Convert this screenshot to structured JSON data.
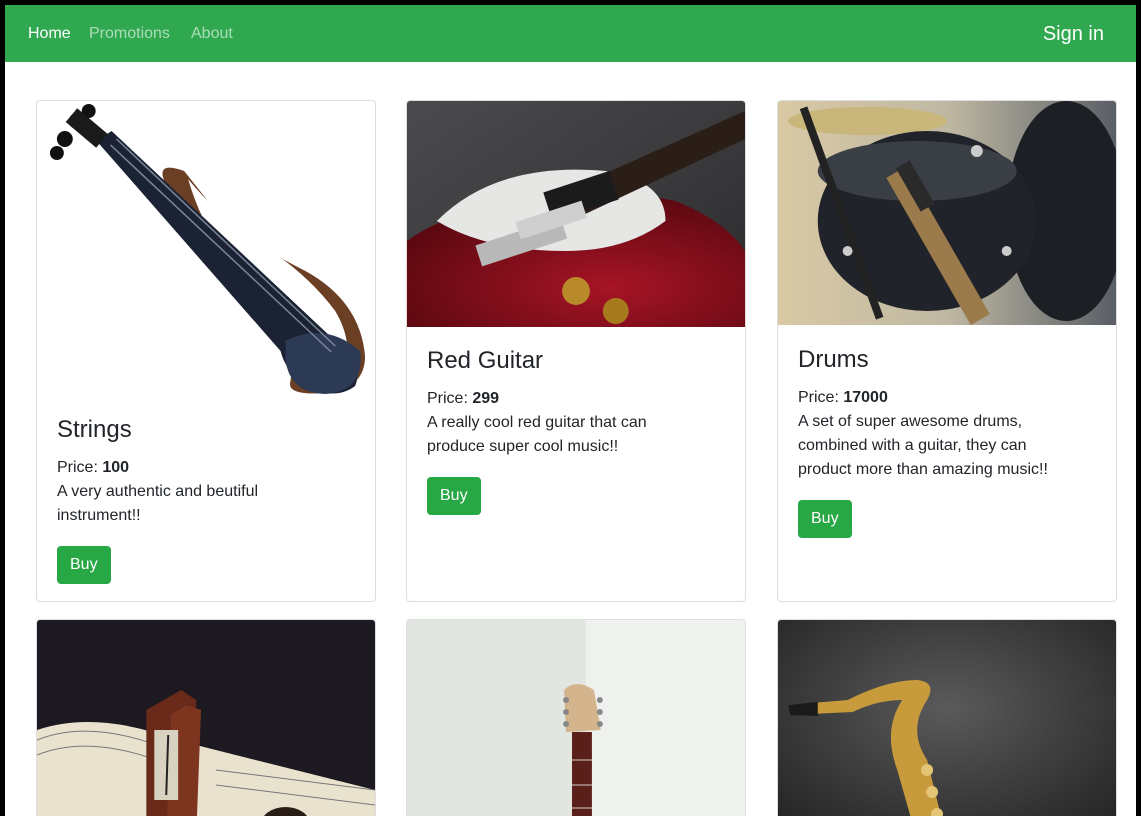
{
  "navbar": {
    "links": [
      {
        "label": "Home",
        "active": true
      },
      {
        "label": "Promotions",
        "active": false
      },
      {
        "label": "About",
        "active": false
      }
    ],
    "signin_label": "Sign in",
    "color": "#2fa84f"
  },
  "price_prefix": "Price: ",
  "products": [
    {
      "title": "Strings",
      "price": "100",
      "description": "A very authentic and beutiful instrument!!",
      "buy_label": "Buy",
      "image": "electric-violin"
    },
    {
      "title": "Red Guitar",
      "price": "299",
      "description": "A really cool red guitar that can produce super cool music!!",
      "buy_label": "Buy",
      "image": "red-electric-guitar"
    },
    {
      "title": "Drums",
      "price": "17000",
      "description": "A set of super awesome drums, combined with a guitar, they can product more than amazing music!!",
      "buy_label": "Buy",
      "image": "drum-kit-with-guitar"
    },
    {
      "image": "metronome-and-sheet-music"
    },
    {
      "image": "guitar-against-wall"
    },
    {
      "image": "saxophone"
    }
  ],
  "accent_color": "#28a745"
}
